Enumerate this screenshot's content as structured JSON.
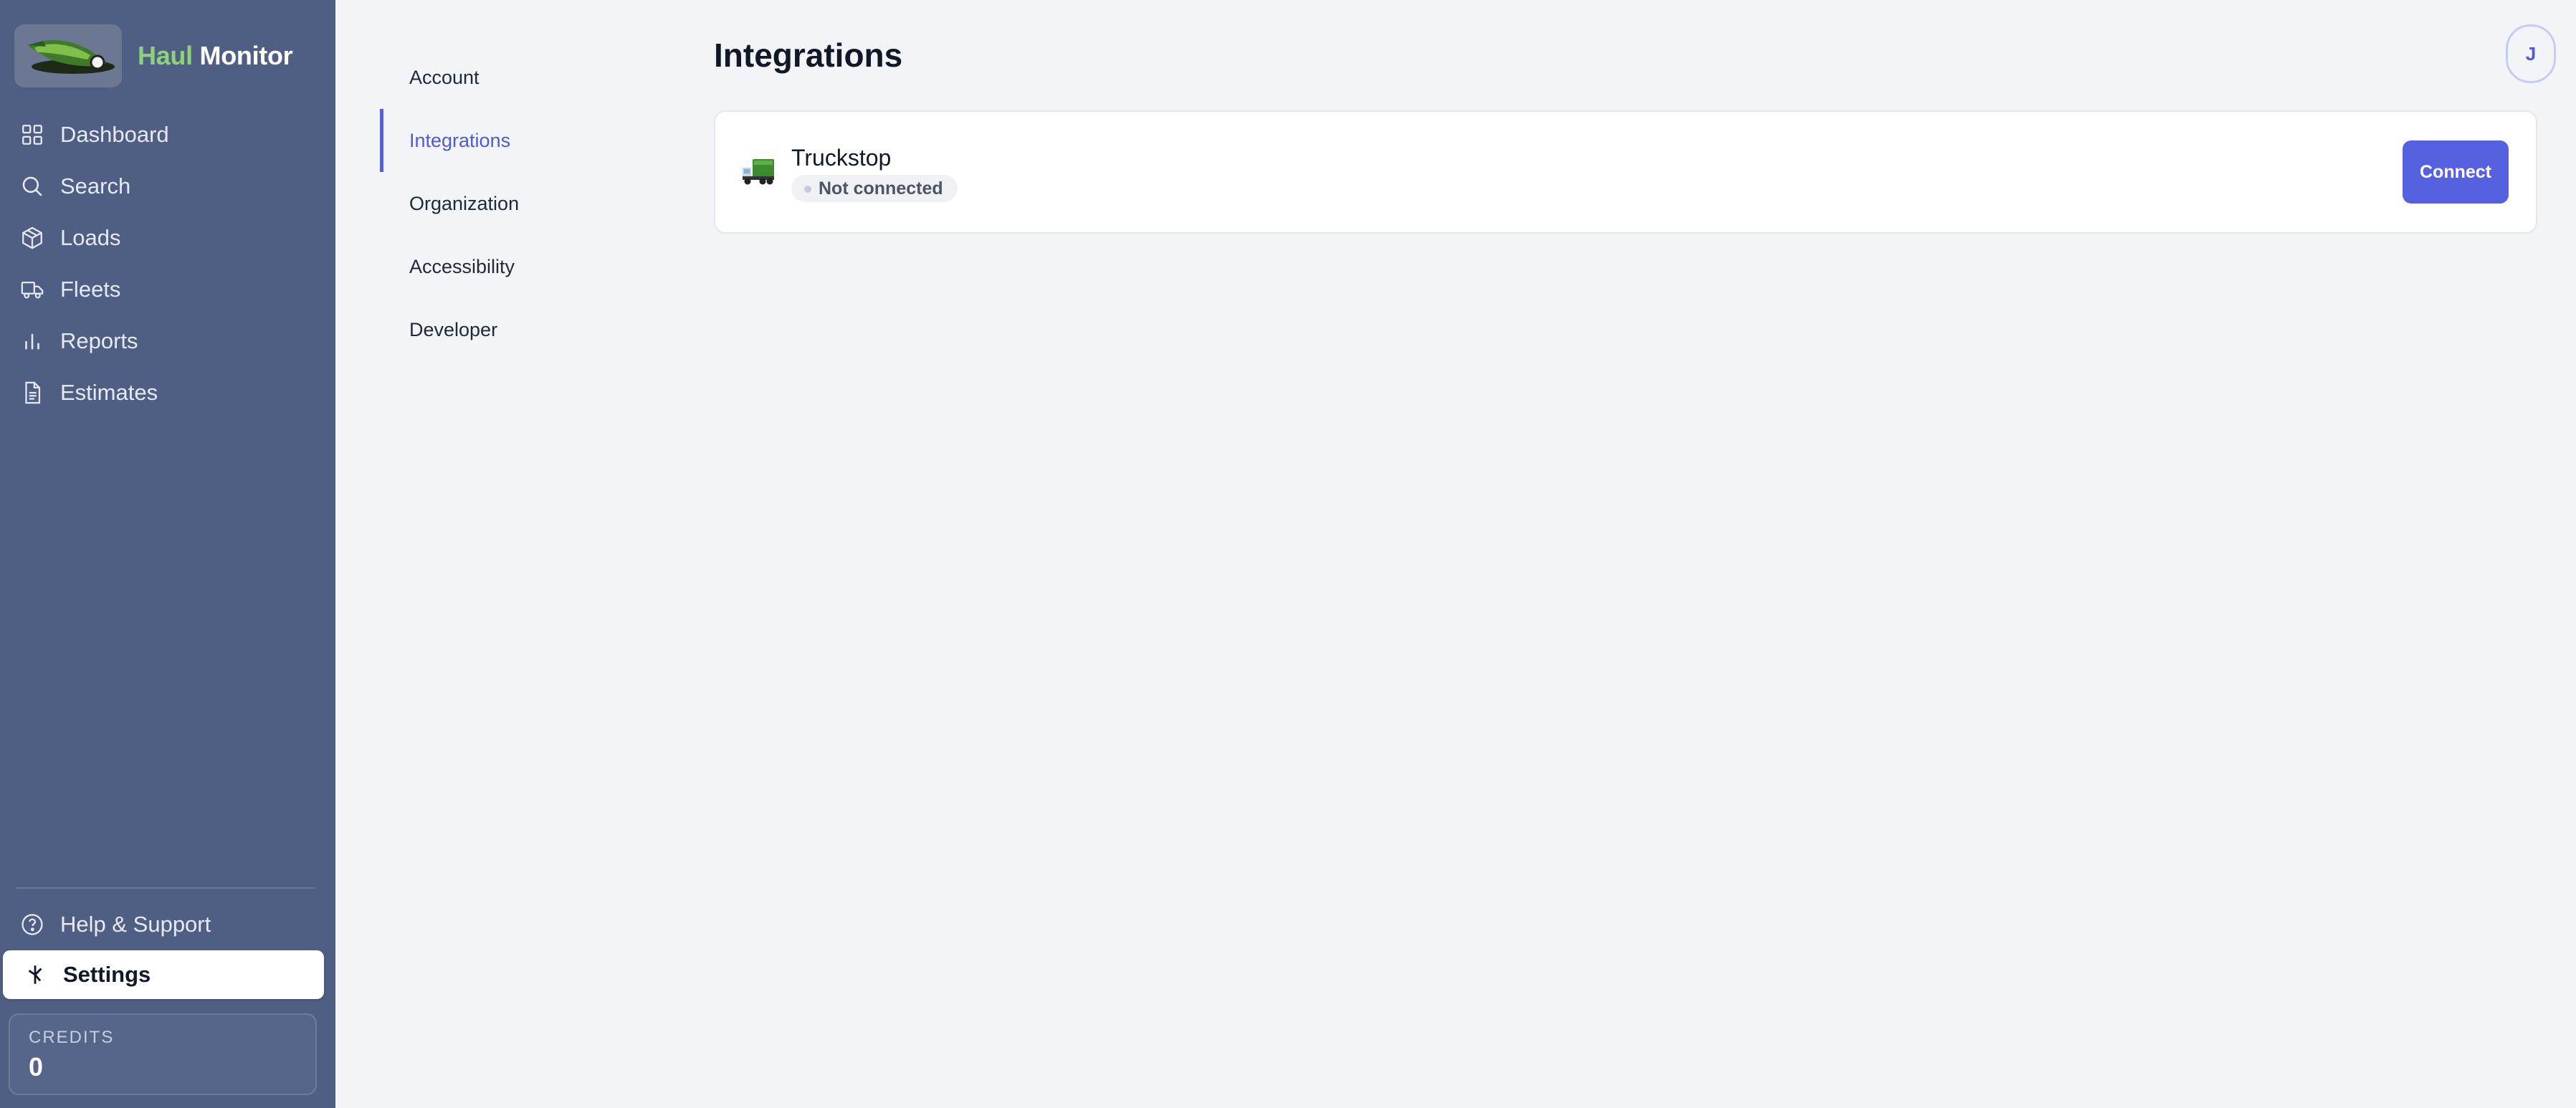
{
  "brand": {
    "name_part1": "Haul",
    "name_part2": "Monitor"
  },
  "sidebar": {
    "items": [
      {
        "label": "Dashboard",
        "icon": "grid-icon"
      },
      {
        "label": "Search",
        "icon": "search-icon"
      },
      {
        "label": "Loads",
        "icon": "box-icon"
      },
      {
        "label": "Fleets",
        "icon": "truck-icon"
      },
      {
        "label": "Reports",
        "icon": "bar-chart-icon"
      },
      {
        "label": "Estimates",
        "icon": "document-icon"
      }
    ],
    "bottom": [
      {
        "label": "Help & Support",
        "icon": "help-circle-icon"
      },
      {
        "label": "Settings",
        "icon": "settings-icon"
      }
    ],
    "credits": {
      "label": "CREDITS",
      "value": "0"
    }
  },
  "settings_nav": {
    "items": [
      {
        "label": "Account"
      },
      {
        "label": "Integrations"
      },
      {
        "label": "Organization"
      },
      {
        "label": "Accessibility"
      },
      {
        "label": "Developer"
      }
    ]
  },
  "main": {
    "title": "Integrations",
    "integrations": [
      {
        "name": "Truckstop",
        "status": "Not connected",
        "action": "Connect"
      }
    ]
  },
  "user": {
    "initial": "J"
  },
  "colors": {
    "sidebar_bg": "#4f5f84",
    "accent": "#5661e0",
    "brand_green": "#8fd17a",
    "page_bg": "#f3f4f8"
  }
}
